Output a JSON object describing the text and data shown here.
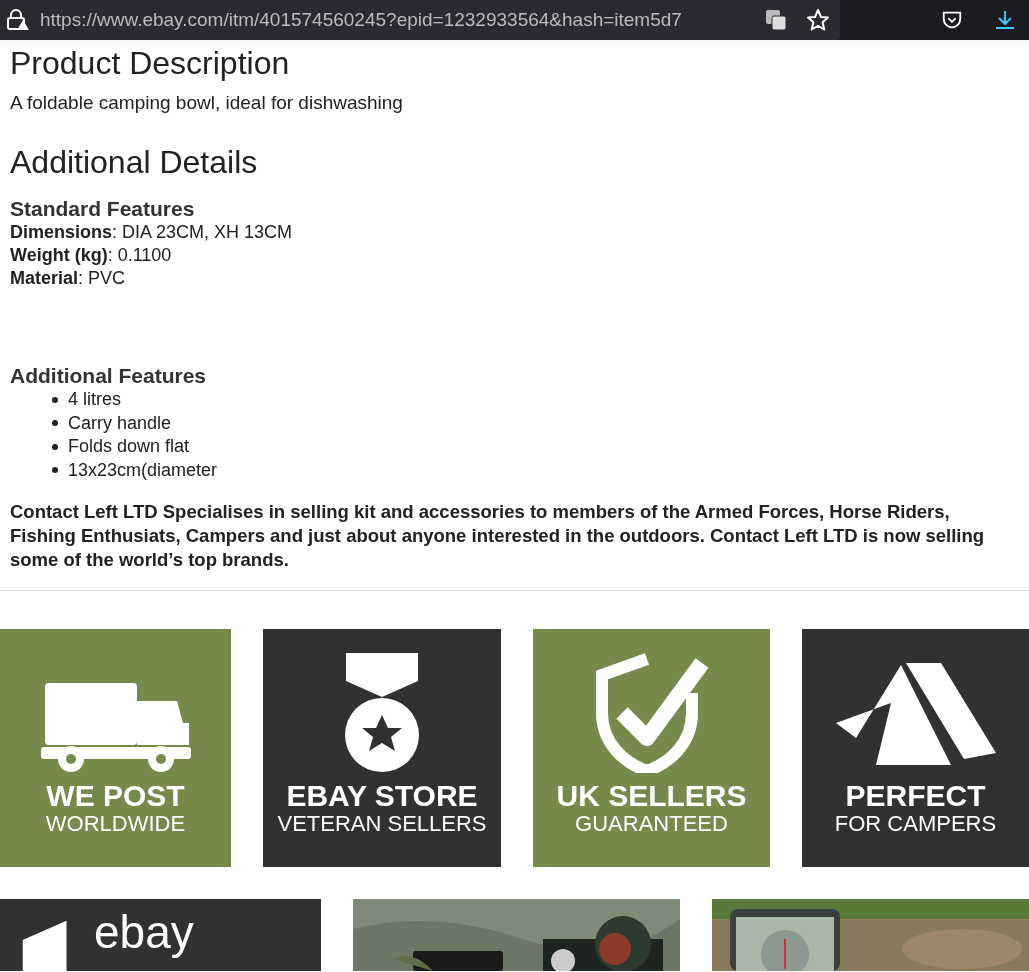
{
  "address_bar": {
    "url": "https://www.ebay.com/itm/401574560245?epid=1232933564&hash=item5d7"
  },
  "description": {
    "heading": "Product Description",
    "text": "A foldable camping bowl, ideal for dishwashing"
  },
  "details": {
    "heading": "Additional Details",
    "standard_heading": "Standard Features",
    "specs": [
      {
        "label": "Dimensions",
        "value": ": DIA 23CM, XH 13CM"
      },
      {
        "label": "Weight (kg)",
        "value": ": 0.1100"
      },
      {
        "label": "Material",
        "value": ": PVC"
      }
    ],
    "additional_heading": "Additional Features",
    "features": [
      "4 litres",
      "Carry handle",
      "Folds down flat",
      "13x23cm(diameter"
    ],
    "about": "Contact Left LTD Specialises in selling kit and accessories to members of the Armed Forces, Horse Riders, Fishing Enthusiats, Campers and just about anyone interested in the outdoors. Contact Left LTD is now selling some of the world’s top brands."
  },
  "badges": [
    {
      "kind": "truck",
      "title": "WE POST",
      "subtitle": "WORLDWIDE",
      "color": "#758a4b"
    },
    {
      "kind": "medal",
      "title": "EBAY STORE",
      "subtitle": "VETERAN SELLERS",
      "color": "#313131"
    },
    {
      "kind": "shield",
      "title": "UK SELLERS",
      "subtitle": "GUARANTEED",
      "color": "#758a4b"
    },
    {
      "kind": "tent",
      "title": "PERFECT",
      "subtitle": "FOR CAMPERS",
      "color": "#313131"
    }
  ],
  "gallery": [
    {
      "kind": "logo",
      "text": "ebay"
    },
    {
      "kind": "picture"
    },
    {
      "kind": "picture"
    }
  ]
}
